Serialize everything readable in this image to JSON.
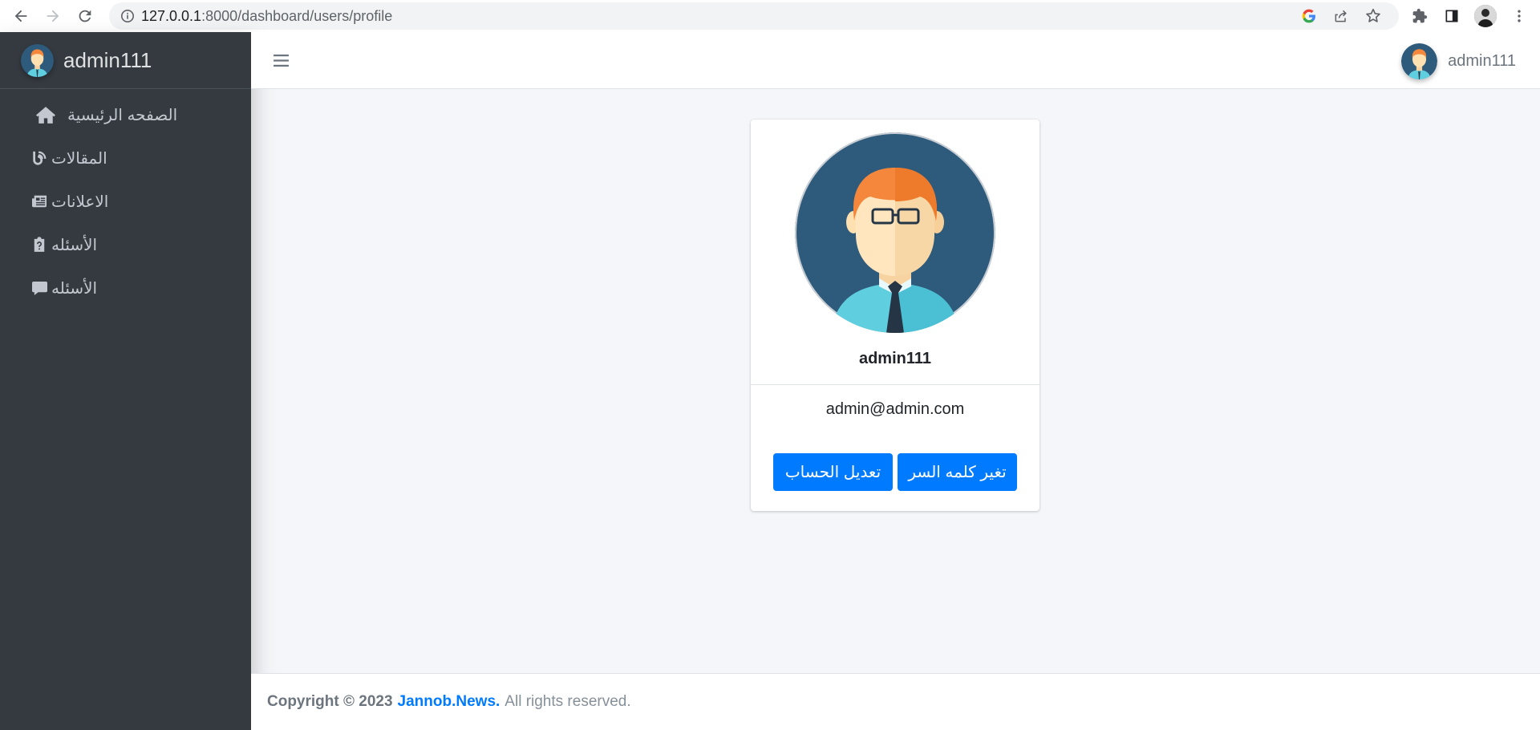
{
  "browser": {
    "url_host": "127.0.0.1",
    "url_path": ":8000/dashboard/users/profile"
  },
  "sidebar": {
    "brand": "admin111",
    "items": [
      {
        "label": "الصفحه الرئيسية",
        "icon": "home-icon"
      },
      {
        "label": "المقالات",
        "icon": "blog-icon"
      },
      {
        "label": "الاعلانات",
        "icon": "newspaper-icon"
      },
      {
        "label": "الأسئله",
        "icon": "clipboard-question-icon"
      },
      {
        "label": "الأسئله",
        "icon": "comment-icon"
      }
    ]
  },
  "header": {
    "username": "admin111"
  },
  "profile": {
    "name": "admin111",
    "email": "admin@admin.com",
    "edit_button": "تعديل الحساب",
    "password_button": "تغير كلمه السر"
  },
  "footer": {
    "copyright": "Copyright © 2023",
    "brand_link": "Jannob.News.",
    "rights": "All rights reserved."
  },
  "colors": {
    "sidebar_bg": "#343a40",
    "primary": "#007bff",
    "page_bg": "#f4f6f9"
  }
}
